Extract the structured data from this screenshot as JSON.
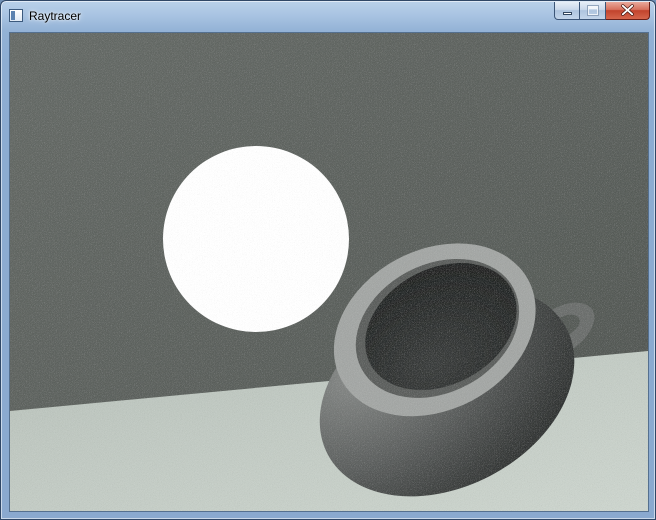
{
  "window": {
    "title": "Raytracer",
    "icon": "window-app-icon"
  },
  "caption_buttons": {
    "minimize_icon": "minimize-icon",
    "maximize_icon": "maximize-icon",
    "close_icon": "close-icon"
  },
  "scene": {
    "objects": [
      "back-wall",
      "floor",
      "emissive-sphere",
      "teapot"
    ],
    "colors": {
      "wall": "#5d625e",
      "floor": "#c3cbc4",
      "sphere": "#ffffff",
      "teapot_rim": "#a7aaa8",
      "teapot_body": "#6b6d6c",
      "teapot_inside": "#2f3130"
    }
  }
}
